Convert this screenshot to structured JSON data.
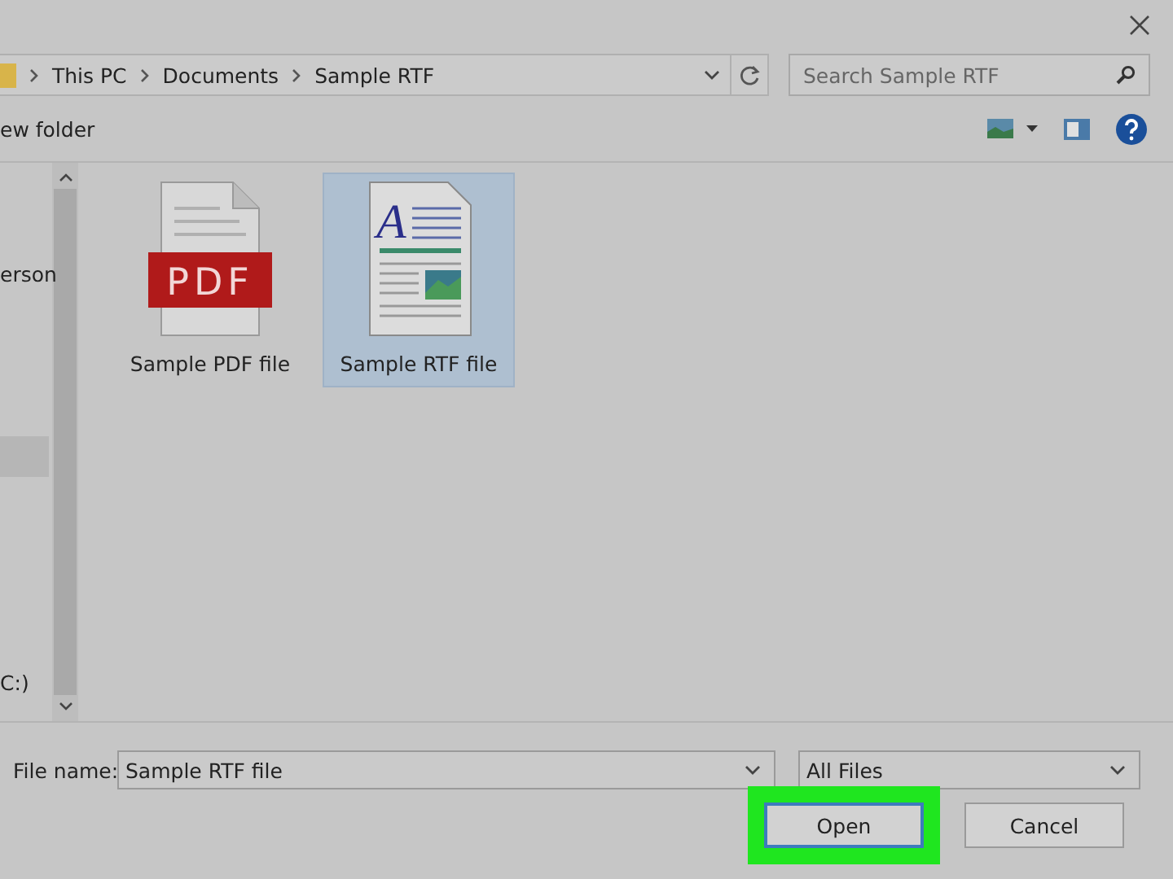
{
  "address_bar": {
    "breadcrumbs": [
      "This PC",
      "Documents",
      "Sample RTF"
    ]
  },
  "search": {
    "placeholder": "Search Sample RTF"
  },
  "toolbar": {
    "new_folder": "ew folder"
  },
  "sidebar": {
    "items": [
      {
        "label": "erson",
        "selected": false
      },
      {
        "selected": true
      },
      {
        "label": "C:)",
        "selected": false
      }
    ]
  },
  "files": [
    {
      "name": "Sample PDF file",
      "kind": "pdf",
      "badge": "PDF",
      "selected": false
    },
    {
      "name": "Sample RTF file",
      "kind": "rtf",
      "glyph": "A",
      "selected": true
    }
  ],
  "file_name": {
    "label": "File name:",
    "value": "Sample RTF file"
  },
  "file_type": {
    "value": "All Files"
  },
  "buttons": [
    {
      "label": "Open",
      "kind": "primary",
      "highlighted": true
    },
    {
      "label": "Cancel",
      "kind": "secondary",
      "highlighted": false
    }
  ]
}
